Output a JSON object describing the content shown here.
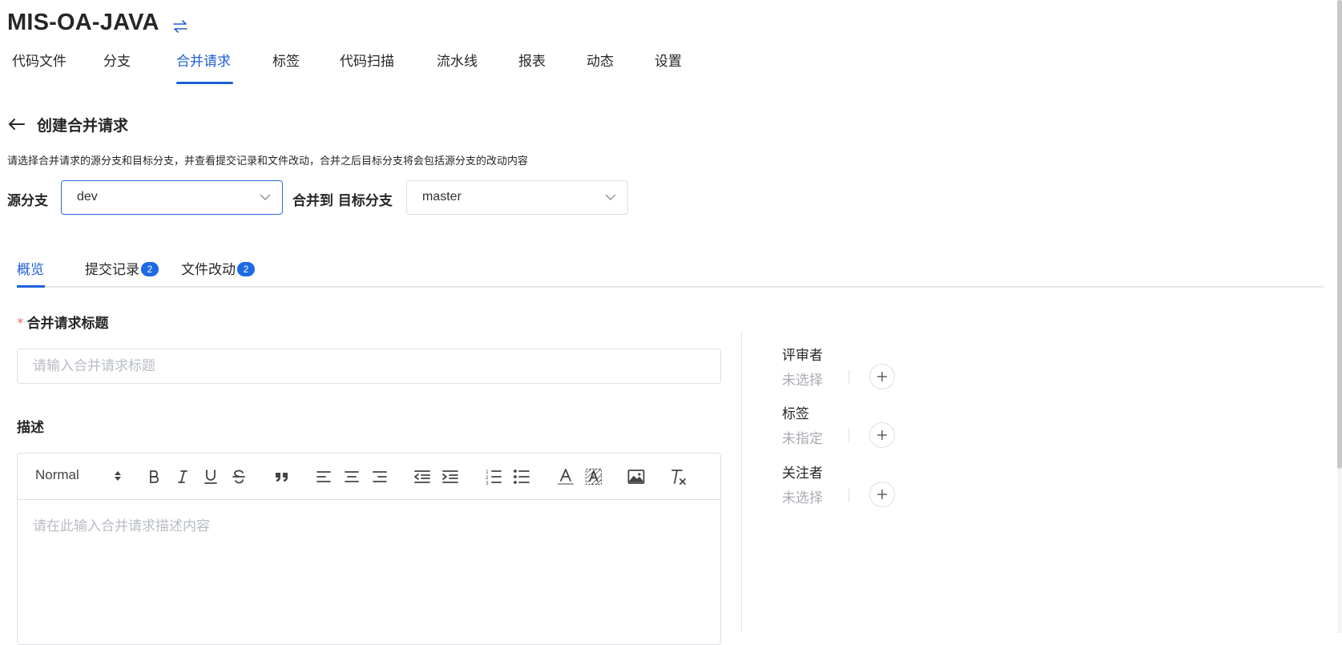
{
  "header": {
    "repo_name": "MIS-OA-JAVA",
    "switch_icon": "switch-arrows-icon",
    "accent_color": "#1f5fd6"
  },
  "nav": {
    "items": [
      {
        "label": "代码文件"
      },
      {
        "label": "分支"
      },
      {
        "label": "合并请求",
        "active": true
      },
      {
        "label": "标签"
      },
      {
        "label": "代码扫描"
      },
      {
        "label": "流水线"
      },
      {
        "label": "报表"
      },
      {
        "label": "动态"
      },
      {
        "label": "设置"
      }
    ]
  },
  "page": {
    "back_icon": "arrow-left-icon",
    "title": "创建合并请求",
    "hint": "请选择合并请求的源分支和目标分支，并查看提交记录和文件改动，合并之后目标分支将会包括源分支的改动内容"
  },
  "branches": {
    "source_label": "源分支",
    "source_value": "dev",
    "merge_label": "合并到 目标分支",
    "target_value": "master"
  },
  "subtabs": [
    {
      "label": "概览",
      "active": true
    },
    {
      "label": "提交记录",
      "badge": "2"
    },
    {
      "label": "文件改动",
      "badge": "2"
    }
  ],
  "form": {
    "title_required_mark": "*",
    "title_label": "合并请求标题",
    "title_placeholder": "请输入合并请求标题",
    "description_label": "描述",
    "description_placeholder": "请在此输入合并请求描述内容",
    "editor": {
      "heading_select": "Normal",
      "tools": [
        "bold-icon",
        "italic-icon",
        "underline-icon",
        "strikethrough-icon",
        "blockquote-icon",
        "align-left-icon",
        "align-center-icon",
        "align-right-icon",
        "outdent-icon",
        "indent-icon",
        "ordered-list-icon",
        "bullet-list-icon",
        "text-color-icon",
        "background-color-icon",
        "image-icon",
        "clear-format-icon"
      ]
    }
  },
  "sidebar": {
    "reviewers_label": "评审者",
    "reviewers_value": "未选择",
    "labels_label": "标签",
    "labels_value": "未指定",
    "watchers_label": "关注者",
    "watchers_value": "未选择"
  }
}
